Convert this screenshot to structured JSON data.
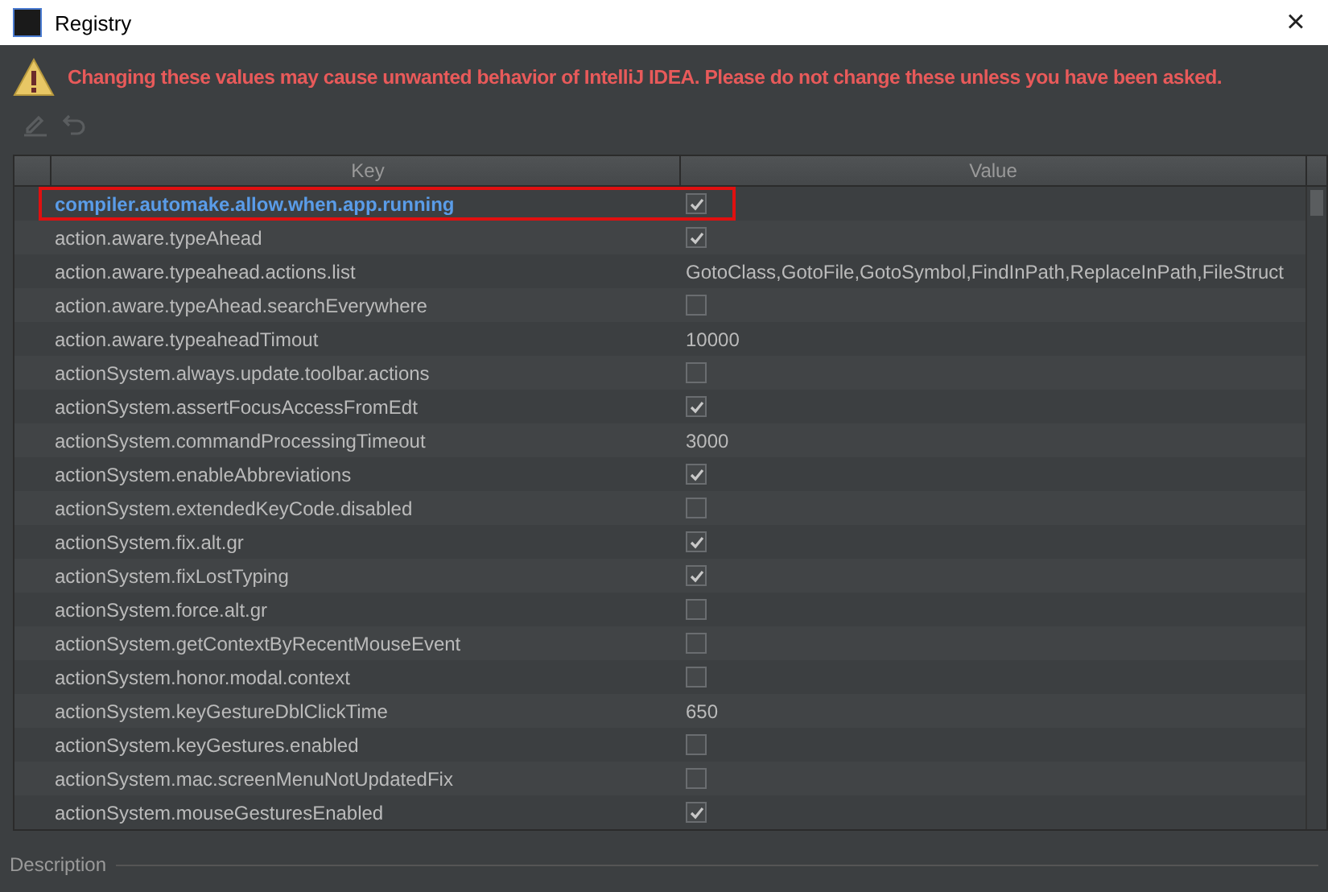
{
  "window": {
    "title": "Registry",
    "close": "×"
  },
  "warning": "Changing these values may cause unwanted behavior of IntelliJ IDEA. Please do not change these unless you have been asked.",
  "toolbar": [
    {
      "kind": "edit",
      "disabled": true
    },
    {
      "kind": "undo",
      "disabled": true
    }
  ],
  "table": {
    "columns": [
      "Key",
      "Value"
    ],
    "rows": [
      {
        "key": "compiler.automake.allow.when.app.running",
        "kind": "checkbox",
        "checked": true,
        "selected": true,
        "outlined": true
      },
      {
        "key": "action.aware.typeAhead",
        "kind": "checkbox",
        "checked": true,
        "selected": false,
        "outlined": false
      },
      {
        "key": "action.aware.typeahead.actions.list",
        "kind": "text",
        "value": "GotoClass,GotoFile,GotoSymbol,FindInPath,ReplaceInPath,FileStruct",
        "selected": false,
        "outlined": false
      },
      {
        "key": "action.aware.typeAhead.searchEverywhere",
        "kind": "checkbox",
        "checked": false,
        "selected": false,
        "outlined": false
      },
      {
        "key": "action.aware.typeaheadTimout",
        "kind": "text",
        "value": "10000",
        "selected": false,
        "outlined": false
      },
      {
        "key": "actionSystem.always.update.toolbar.actions",
        "kind": "checkbox",
        "checked": false,
        "selected": false,
        "outlined": false
      },
      {
        "key": "actionSystem.assertFocusAccessFromEdt",
        "kind": "checkbox",
        "checked": true,
        "selected": false,
        "outlined": false
      },
      {
        "key": "actionSystem.commandProcessingTimeout",
        "kind": "text",
        "value": "3000",
        "selected": false,
        "outlined": false
      },
      {
        "key": "actionSystem.enableAbbreviations",
        "kind": "checkbox",
        "checked": true,
        "selected": false,
        "outlined": false
      },
      {
        "key": "actionSystem.extendedKeyCode.disabled",
        "kind": "checkbox",
        "checked": false,
        "selected": false,
        "outlined": false
      },
      {
        "key": "actionSystem.fix.alt.gr",
        "kind": "checkbox",
        "checked": true,
        "selected": false,
        "outlined": false
      },
      {
        "key": "actionSystem.fixLostTyping",
        "kind": "checkbox",
        "checked": true,
        "selected": false,
        "outlined": false
      },
      {
        "key": "actionSystem.force.alt.gr",
        "kind": "checkbox",
        "checked": false,
        "selected": false,
        "outlined": false
      },
      {
        "key": "actionSystem.getContextByRecentMouseEvent",
        "kind": "checkbox",
        "checked": false,
        "selected": false,
        "outlined": false
      },
      {
        "key": "actionSystem.honor.modal.context",
        "kind": "checkbox",
        "checked": false,
        "selected": false,
        "outlined": false
      },
      {
        "key": "actionSystem.keyGestureDblClickTime",
        "kind": "text",
        "value": "650",
        "selected": false,
        "outlined": false
      },
      {
        "key": "actionSystem.keyGestures.enabled",
        "kind": "checkbox",
        "checked": false,
        "selected": false,
        "outlined": false
      },
      {
        "key": "actionSystem.mac.screenMenuNotUpdatedFix",
        "kind": "checkbox",
        "checked": false,
        "selected": false,
        "outlined": false
      },
      {
        "key": "actionSystem.mouseGesturesEnabled",
        "kind": "checkbox",
        "checked": true,
        "selected": false,
        "outlined": false
      }
    ]
  },
  "description_label": "Description"
}
